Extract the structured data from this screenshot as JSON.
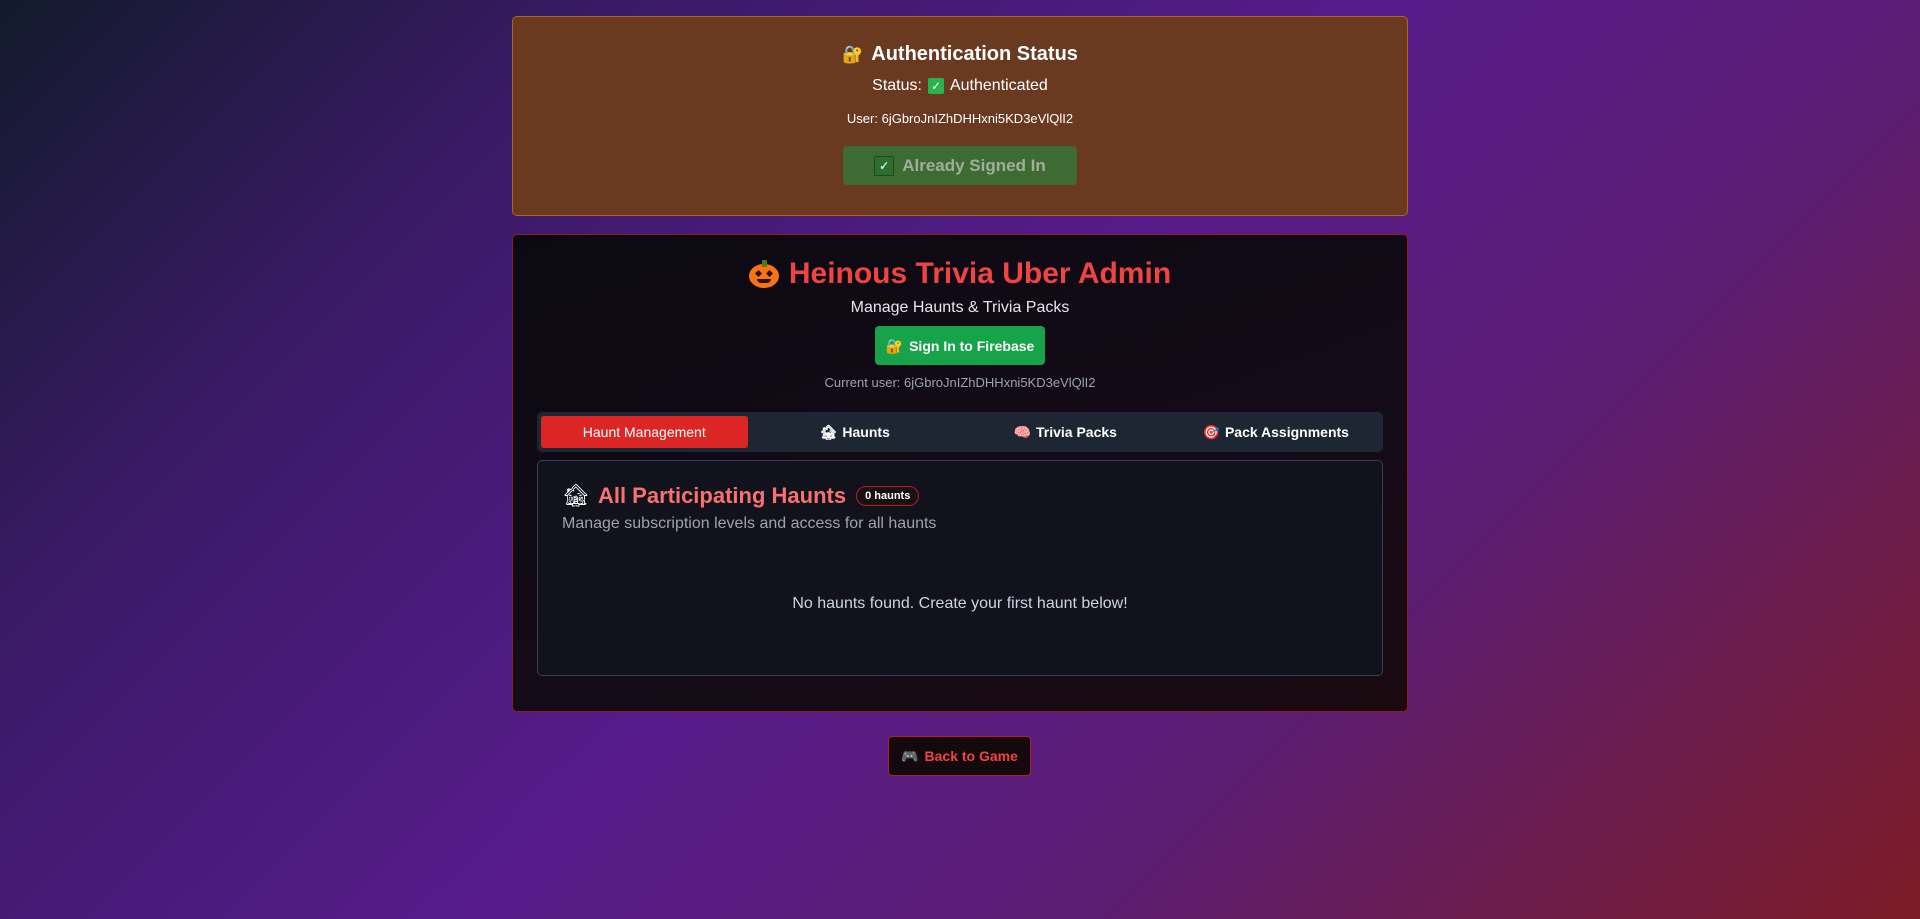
{
  "auth": {
    "title": "Authentication Status",
    "status_label": "Status:",
    "status_value": "Authenticated",
    "user_line": "User: 6jGbroJnIZhDHHxni5KD3eVlQlI2",
    "signed_in_button": "Already Signed In"
  },
  "admin": {
    "title": "Heinous Trivia Uber Admin",
    "subtitle": "Manage Haunts & Trivia Packs",
    "sign_in_button": "Sign In to Firebase",
    "current_user": "Current user: 6jGbroJnIZhDHHxni5KD3eVlQlI2"
  },
  "tabs": [
    {
      "label": "Haunt Management",
      "icon": "",
      "active": true
    },
    {
      "label": "Haunts",
      "icon": "house-icon",
      "active": false
    },
    {
      "label": "Trivia Packs",
      "icon": "brain-icon",
      "active": false
    },
    {
      "label": "Pack Assignments",
      "icon": "target-icon",
      "active": false
    }
  ],
  "panel": {
    "title": "All Participating Haunts",
    "badge": "0 haunts",
    "description": "Manage subscription levels and access for all haunts",
    "empty_message": "No haunts found. Create your first haunt below!"
  },
  "back_button": "Back to Game",
  "colors": {
    "accent_red": "#ef4444",
    "success_green": "#16a34a",
    "auth_card_bg": "#6a3a20"
  }
}
